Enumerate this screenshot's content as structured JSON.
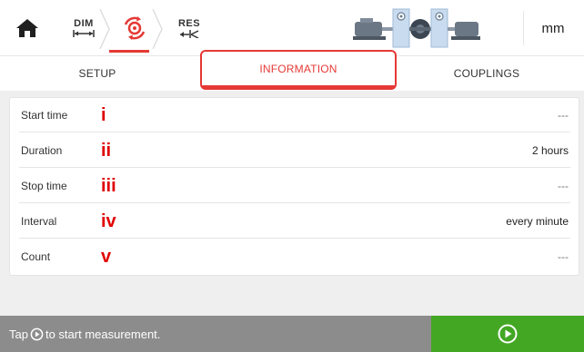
{
  "toolbar": {
    "home_icon": "home-icon",
    "steps": [
      {
        "id": "dim",
        "label": "DIM",
        "icon": "dimension-arrows-icon"
      },
      {
        "id": "measure",
        "label": "",
        "icon": "measure-rotation-icon"
      },
      {
        "id": "res",
        "label": "RES",
        "icon": "results-arrows-icon"
      }
    ],
    "machine_icon": "machine-train-icon",
    "unit": "mm",
    "accent": "#e53935"
  },
  "tabs": [
    {
      "label": "SETUP",
      "active": false
    },
    {
      "label": "INFORMATION",
      "active": true
    },
    {
      "label": "COUPLINGS",
      "active": false
    }
  ],
  "rows": [
    {
      "label": "Start time",
      "marker": "i",
      "value": "---"
    },
    {
      "label": "Duration",
      "marker": "ii",
      "value": "2 hours"
    },
    {
      "label": "Stop time",
      "marker": "iii",
      "value": "---"
    },
    {
      "label": "Interval",
      "marker": "iv",
      "value": "every minute"
    },
    {
      "label": "Count",
      "marker": "v",
      "value": "---"
    }
  ],
  "footer": {
    "hint_before": "Tap",
    "hint_after": "to start measurement.",
    "play_icon": "play-circle-icon",
    "start_button_icon": "play-circle-icon",
    "start_color": "#43a724"
  }
}
